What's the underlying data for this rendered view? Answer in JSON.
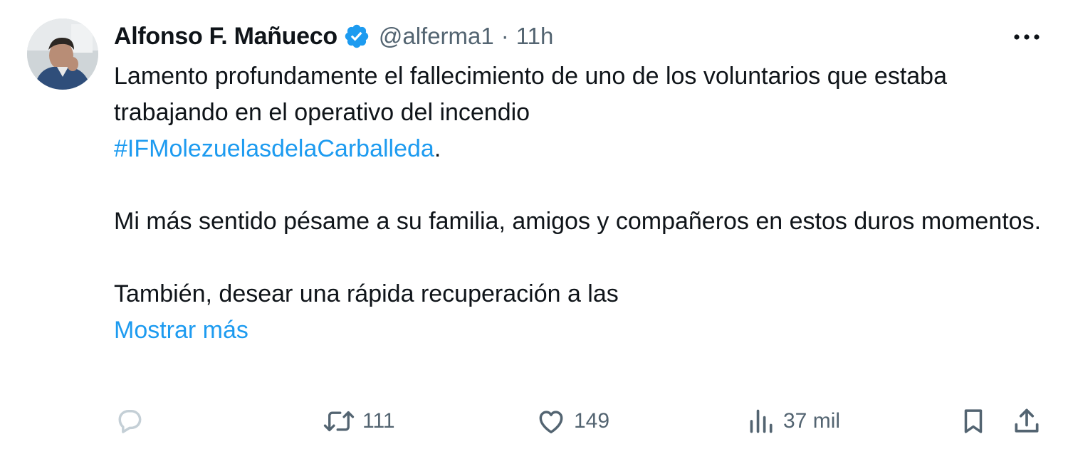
{
  "author": {
    "name": "Alfonso F. Mañueco",
    "handle": "@alferma1",
    "separator": "·",
    "time": "11h",
    "verified": true
  },
  "body": {
    "line1": "Lamento profundamente el fallecimiento de uno de los voluntarios que estaba trabajando en el operativo del incendio",
    "hashtag": "#IFMolezuelasdelaCarballeda",
    "line1_end": ".",
    "paragraph2": "Mi más sentido pésame a su familia, amigos y compañeros en estos duros momentos.",
    "paragraph3": "También, desear una rápida recuperación a las",
    "show_more": "Mostrar más"
  },
  "actions": {
    "reply_count": "",
    "retweet_count": "111",
    "like_count": "149",
    "views_count": "37 mil"
  },
  "icons": {
    "verified": "verified-badge-icon",
    "more": "more-options-icon",
    "reply": "reply-icon",
    "retweet": "retweet-icon",
    "like": "heart-icon",
    "views": "views-icon",
    "bookmark": "bookmark-icon",
    "share": "share-icon"
  },
  "colors": {
    "accent": "#1d9bf0",
    "text": "#0f1419",
    "muted": "#536471"
  }
}
